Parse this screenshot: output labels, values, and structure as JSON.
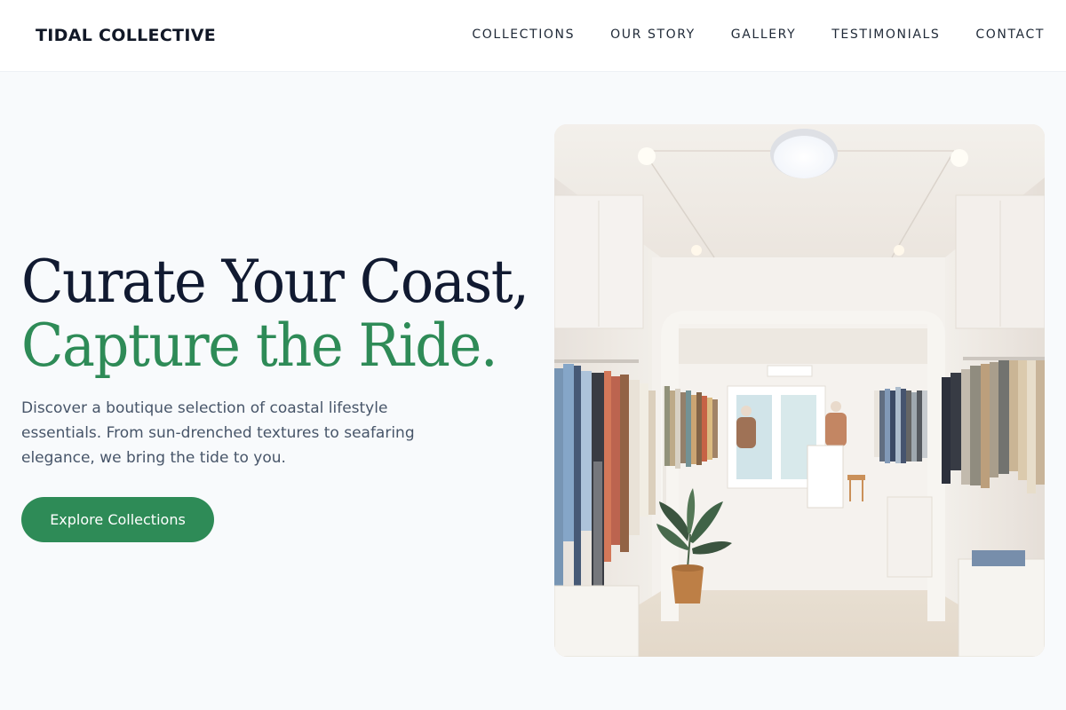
{
  "header": {
    "brand": "TIDAL COLLECTIVE",
    "nav": [
      {
        "label": "COLLECTIONS"
      },
      {
        "label": "OUR STORY"
      },
      {
        "label": "GALLERY"
      },
      {
        "label": "TESTIMONIALS"
      },
      {
        "label": "CONTACT"
      }
    ]
  },
  "hero": {
    "headline_line1": "Curate Your Coast,",
    "headline_line2": "Capture the Ride.",
    "description": "Discover a boutique selection of coastal lifestyle essentials. From sun-drenched textures to seafaring elegance, we bring the tide to you.",
    "cta_label": "Explore Collections",
    "image_alt": "Interior of a bright clothing boutique with racks of garments"
  },
  "colors": {
    "accent": "#2e8b57",
    "heading": "#111a31",
    "body_text": "#475569",
    "page_bg": "#f8fafc"
  }
}
